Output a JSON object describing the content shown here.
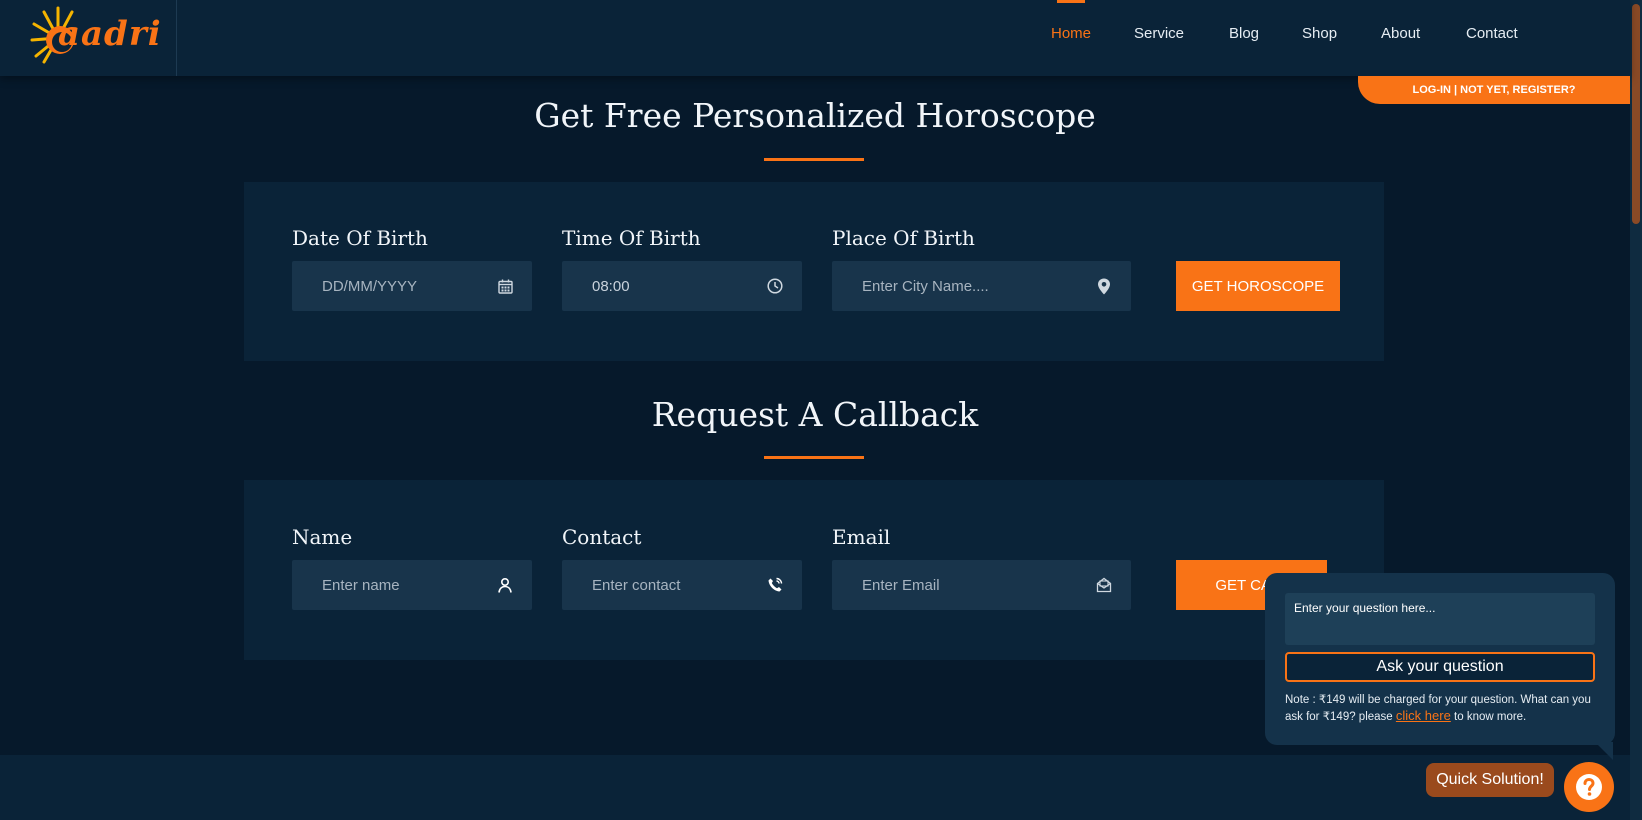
{
  "brand": {
    "logo_text": "aadri"
  },
  "nav": {
    "items": [
      {
        "label": "Home",
        "active": true
      },
      {
        "label": "Service"
      },
      {
        "label": "Blog"
      },
      {
        "label": "Shop"
      },
      {
        "label": "About"
      },
      {
        "label": "Contact"
      }
    ]
  },
  "login_tab": "LOG-IN | NOT YET, REGISTER?",
  "horoscope": {
    "title": "Get Free Personalized Horoscope",
    "dob_label": "Date Of Birth",
    "dob_placeholder": "DD/MM/YYYY",
    "tob_label": "Time Of Birth",
    "tob_value": "08:00",
    "pob_label": "Place Of Birth",
    "pob_placeholder": "Enter City Name....",
    "button": "GET HOROSCOPE"
  },
  "callback": {
    "title": "Request A Callback",
    "name_label": "Name",
    "name_placeholder": "Enter name",
    "contact_label": "Contact",
    "contact_placeholder": "Enter contact",
    "email_label": "Email",
    "email_placeholder": "Enter Email",
    "button": "GET CALL"
  },
  "quick_solution": {
    "question_placeholder": "Enter your question here...",
    "ask_button": "Ask your question",
    "note_prefix": "Note : ₹149 will be charged for your question. What can you ask for ₹149? please",
    "note_link": "click here",
    "note_suffix": "to know more.",
    "pill_label": "Quick Solution!",
    "fab_icon": "question-mark-icon"
  },
  "colors": {
    "accent": "#f97316",
    "background": "#06192b",
    "panel": "#0a2338",
    "field": "#18344b"
  }
}
